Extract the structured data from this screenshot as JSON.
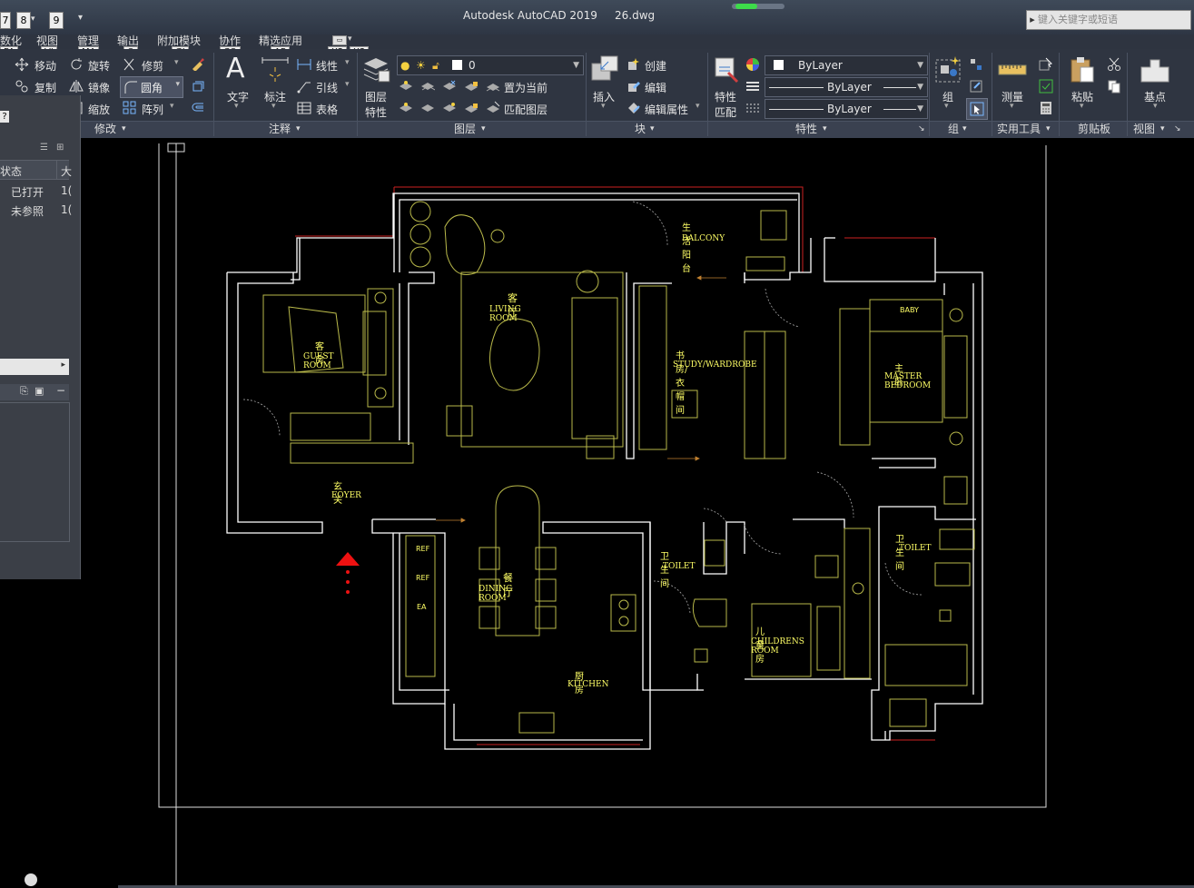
{
  "titlebar": {
    "app_title": "Autodesk AutoCAD 2019",
    "filename": "26.dwg",
    "search_placeholder": "键入关键字或短语",
    "qat_keys": [
      "7",
      "8",
      "9"
    ]
  },
  "ribbon_tabs": [
    {
      "label": "数化",
      "key": "PA"
    },
    {
      "label": "视图",
      "key": "VI"
    },
    {
      "label": "管理",
      "key": "MA"
    },
    {
      "label": "输出",
      "key": "O"
    },
    {
      "label": "附加模块",
      "key": "GI"
    },
    {
      "label": "协作",
      "key": "CO"
    },
    {
      "label": "精选应用",
      "key": "AP"
    },
    {
      "label": "",
      "key": "X2"
    },
    {
      "label": "",
      "key": "X3"
    }
  ],
  "modify": {
    "move": "移动",
    "rotate": "旋转",
    "trim": "修剪",
    "copy": "复制",
    "mirror": "镜像",
    "fillet": "圆角",
    "scale": "缩放",
    "array": "阵列",
    "panel_label": "修改"
  },
  "annotation": {
    "text": "文字",
    "dimension": "标注",
    "linetype": "线性",
    "leader": "引线",
    "table": "表格",
    "panel_label": "注释"
  },
  "layers": {
    "layer_props_line1": "图层",
    "layer_props_line2": "特性",
    "current_layer": "0",
    "make_current": "置为当前",
    "match_layer": "匹配图层",
    "panel_label": "图层"
  },
  "block": {
    "insert": "插入",
    "create": "创建",
    "edit": "编辑",
    "edit_attr": "编辑属性",
    "panel_label": "块"
  },
  "properties": {
    "match_line1": "特性",
    "match_line2": "匹配",
    "color": "ByLayer",
    "lineweight": "ByLayer",
    "linetype": "ByLayer",
    "panel_label": "特性"
  },
  "groups": {
    "group": "组",
    "panel_label": "组"
  },
  "utilities": {
    "measure": "测量",
    "panel_label": "实用工具"
  },
  "clipboard": {
    "paste": "粘贴",
    "panel_label": "剪贴板"
  },
  "view": {
    "base": "基点",
    "panel_label": "视图"
  },
  "palette": {
    "col_status": "状态",
    "col_size": "大",
    "rows": [
      {
        "status": "已打开",
        "size": "1("
      },
      {
        "status": "未参照",
        "size": "1("
      }
    ]
  },
  "rooms": [
    {
      "cn": "客厅",
      "en": "LIVING ROOM"
    },
    {
      "cn": "生活阳台",
      "en": "BALCONY"
    },
    {
      "cn": "客房",
      "en": "GUEST ROOM"
    },
    {
      "cn": "书房/衣帽间",
      "en": "STUDY/WARDROBE"
    },
    {
      "cn": "主卧",
      "en": "MASTER BEDROOM"
    },
    {
      "cn": "玄关",
      "en": "FOYER"
    },
    {
      "cn": "餐 厅",
      "en": "DINING ROOM"
    },
    {
      "cn": "卫生间",
      "en": "TOILET"
    },
    {
      "cn": "卫生间",
      "en": "TOILET"
    },
    {
      "cn": "儿童房",
      "en": "CHILDRENS ROOM"
    },
    {
      "cn": "厨房",
      "en": "KITCHEN"
    }
  ],
  "fixtures": {
    "baby": "BABY",
    "ref1": "REF",
    "ref2": "REF",
    "ea": "EA"
  },
  "colors": {
    "wall": "#ffffff",
    "label": "#ffff66",
    "furniture": "#b9b94a",
    "red_line": "#cc2222",
    "arrow": "#ee1111"
  }
}
